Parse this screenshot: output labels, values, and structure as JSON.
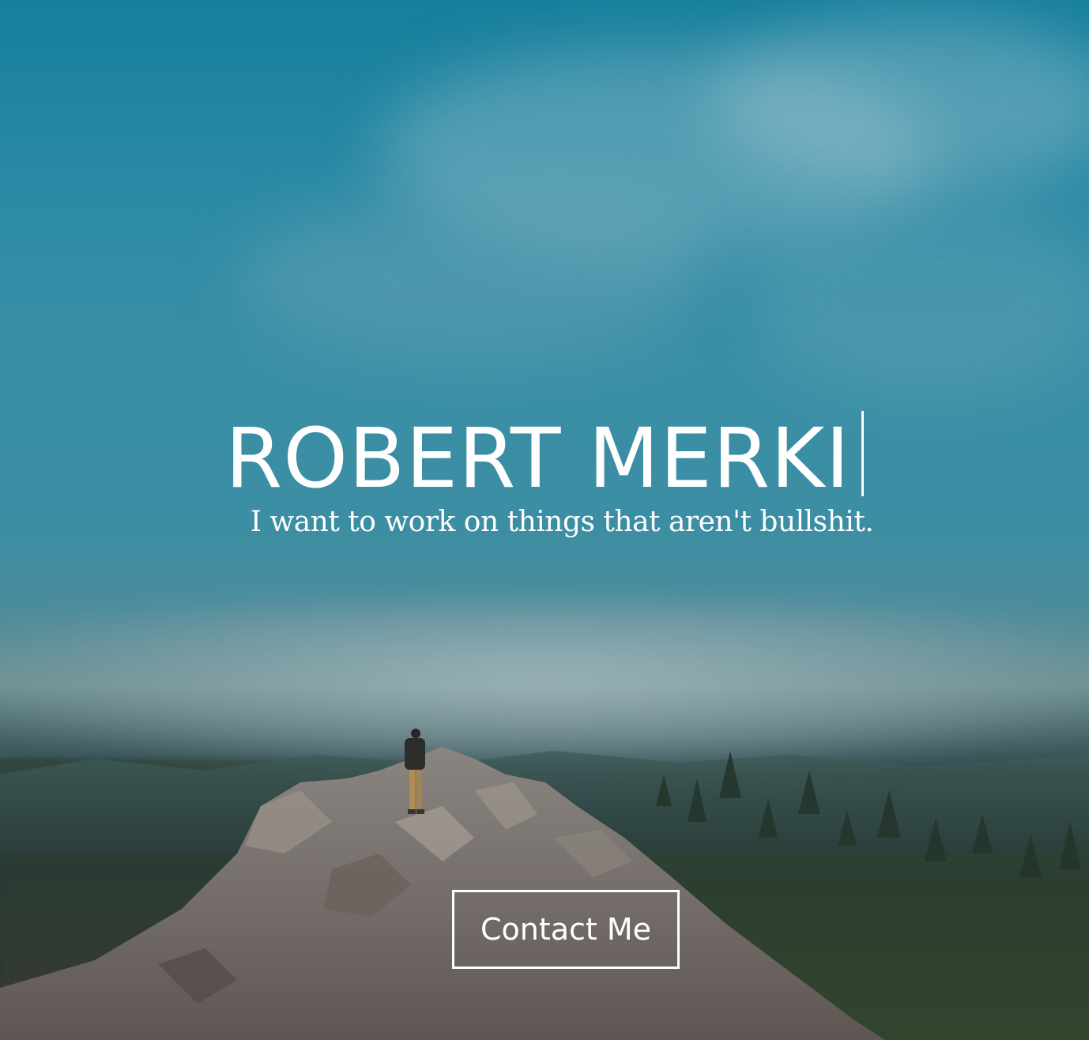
{
  "hero": {
    "title": "ROBERT MERKI",
    "tagline": "I want to work on things that aren't bullshit.",
    "background_image": "mountain-ridge-hiker-clouds"
  },
  "cta": {
    "label": "Contact Me"
  },
  "colors": {
    "sky_top": "#157f9d",
    "sky_mid": "#3b8ea3",
    "ground": "#1f3638",
    "text": "#ffffff"
  }
}
